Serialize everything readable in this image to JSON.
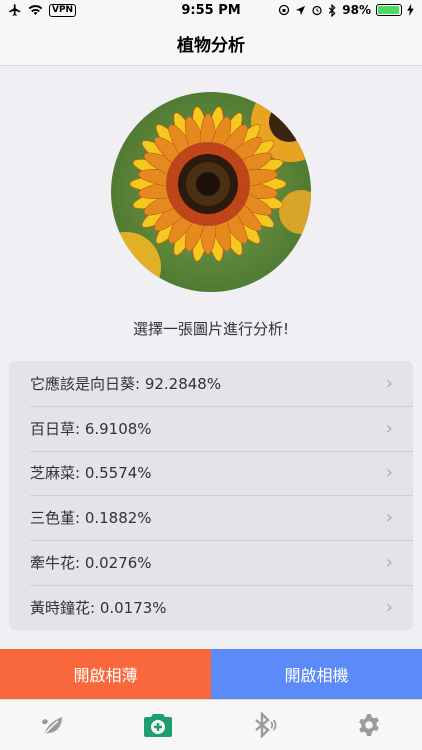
{
  "status": {
    "vpn": "VPN",
    "time": "9:55 PM",
    "battery": "98%"
  },
  "nav": {
    "title": "植物分析"
  },
  "prompt": "選擇一張圖片進行分析!",
  "results": [
    {
      "label": "它應該是向日葵: 92.2848%"
    },
    {
      "label": "百日草: 6.9108%"
    },
    {
      "label": "芝麻菜: 0.5574%"
    },
    {
      "label": "三色堇: 0.1882%"
    },
    {
      "label": "牽牛花: 0.0276%"
    },
    {
      "label": "黃時鐘花: 0.0173%"
    }
  ],
  "actions": {
    "album": "開啟相薄",
    "camera": "開啟相機"
  },
  "tabs": [
    {
      "icon": "leaf-icon",
      "active": false
    },
    {
      "icon": "camera-add-icon",
      "active": true
    },
    {
      "icon": "bluetooth-icon",
      "active": false
    },
    {
      "icon": "gear-icon",
      "active": false
    }
  ],
  "colors": {
    "album_button": "#f9683c",
    "camera_button": "#5c8bf9",
    "active_tab": "#1f9e6e",
    "inactive_tab": "#9b9b9b",
    "battery": "#4cd964"
  }
}
